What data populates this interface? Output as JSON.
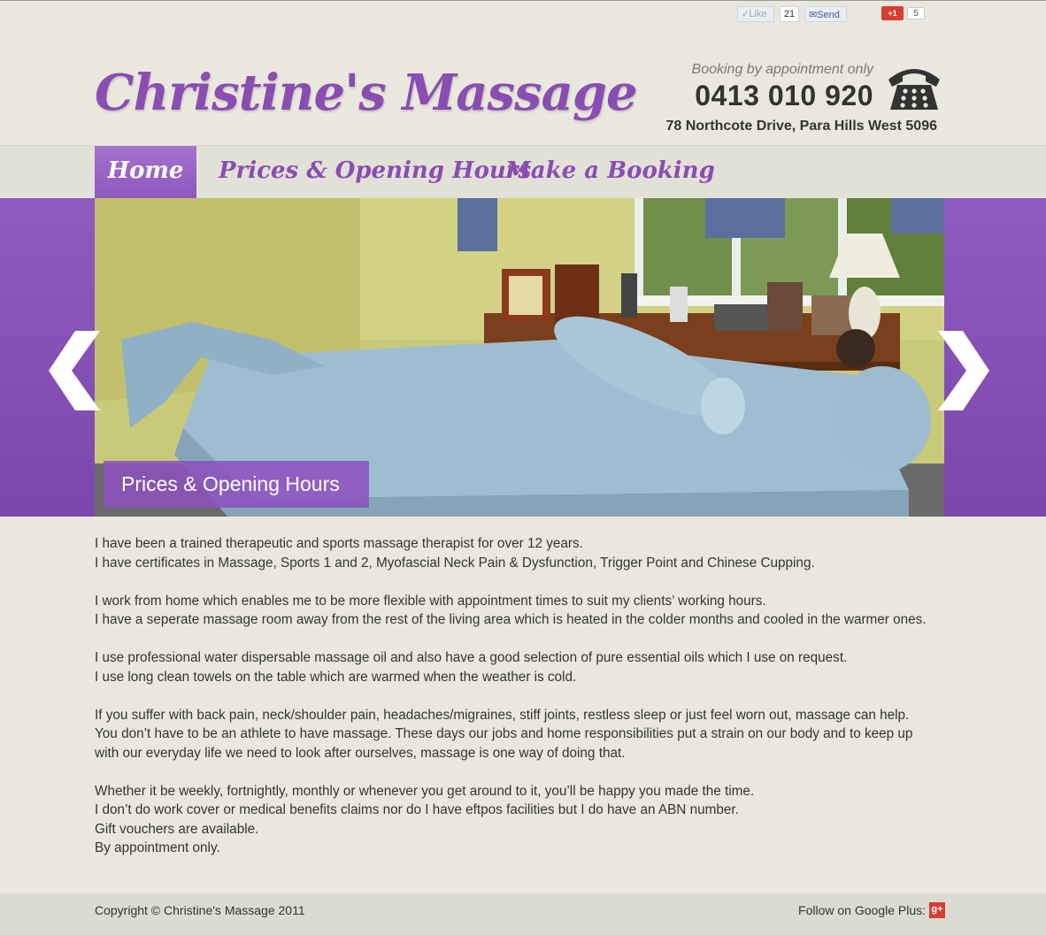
{
  "social": {
    "like_label": "Like",
    "like_count": "21",
    "send_label": "Send",
    "gplus_label": "+1",
    "gplus_count": "5"
  },
  "header": {
    "logo": "Christine's Massage",
    "booking_note": "Booking by appointment only",
    "phone": "0413 010 920",
    "address": "78 Northcote Drive, Para Hills West 5096"
  },
  "nav": {
    "items": [
      {
        "label": "Home",
        "active": true
      },
      {
        "label": "Prices & Opening Hours",
        "active": false
      },
      {
        "label": "Make a Booking",
        "active": false
      }
    ]
  },
  "slider": {
    "caption": "Prices & Opening Hours"
  },
  "content": {
    "paragraphs": [
      [
        "I have been a trained therapeutic and sports massage therapist for over 12 years.",
        "I have certificates in Massage, Sports 1 and 2, Myofascial Neck Pain & Dysfunction, Trigger Point and Chinese Cupping."
      ],
      [
        "I work from home which enables me to be more flexible with appointment times to suit my clients’ working hours.",
        "I have a seperate massage room away from the rest of the living area which is heated in the colder months and cooled in the warmer ones."
      ],
      [
        "I use professional water dispersable massage oil and also have a good selection of pure essential oils which I use on request.",
        "I use long clean towels on the table which are warmed when the weather is cold."
      ],
      [
        "If you suffer with back pain, neck/shoulder pain, headaches/migraines, stiff joints, restless sleep or just feel worn out, massage can help.",
        "You don’t have to be an athlete to have massage. These days our jobs and home responsibilities put a strain on our body and to keep up",
        "with our everyday life we need to look after ourselves, massage is one way of doing that."
      ],
      [
        "Whether it be weekly, fortnightly, monthly or whenever you get around to it, you’ll be happy you made the time.",
        "I don’t do work cover or medical benefits claims nor do I have eftpos facilities but I do have an ABN number.",
        "Gift vouchers are available.",
        "By appointment only."
      ]
    ]
  },
  "footer": {
    "copyright": "Copyright © Christine's Massage 2011",
    "follow": "Follow on Google Plus:",
    "gplus_icon": "g+"
  },
  "colors": {
    "brand_purple": "#8a4db2",
    "background": "#eae8de"
  }
}
